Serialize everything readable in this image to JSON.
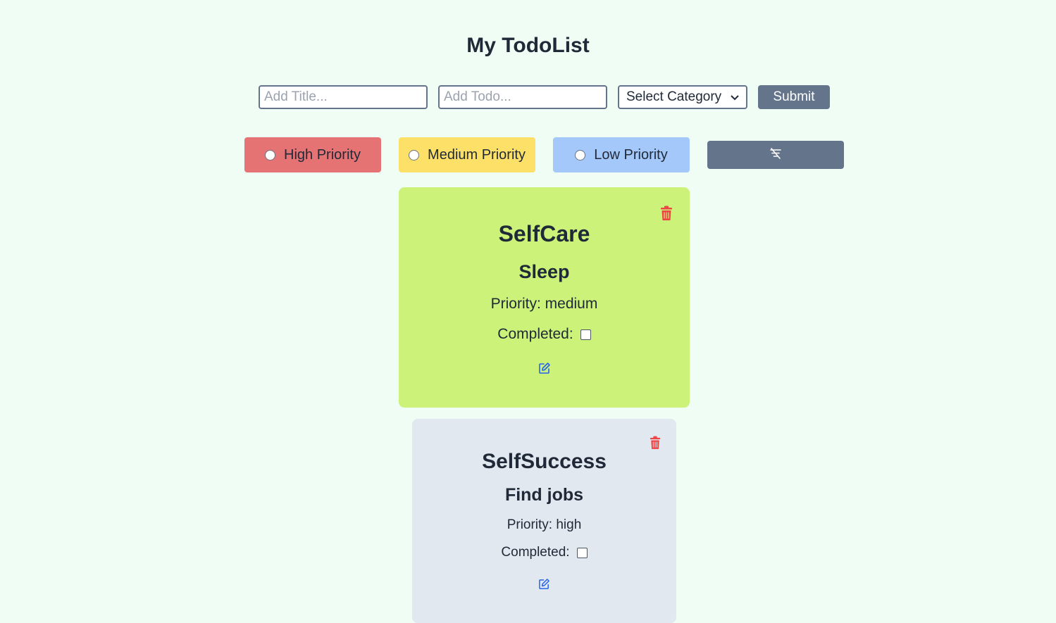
{
  "header": {
    "title": "My TodoList"
  },
  "form": {
    "title_placeholder": "Add Title...",
    "todo_placeholder": "Add Todo...",
    "category_selected": "Select Category",
    "submit_label": "Submit"
  },
  "filters": {
    "high_label": "High Priority",
    "medium_label": "Medium Priority",
    "low_label": "Low Priority",
    "clear_icon": "filter-off-icon"
  },
  "colors": {
    "high": "#e57373",
    "medium": "#fde068",
    "low": "#a5c8fa",
    "delete": "#ef4444",
    "edit": "#2563eb"
  },
  "todos": [
    {
      "category": "SelfCare",
      "title": "Sleep",
      "priority_text": "Priority: medium",
      "completed_label": "Completed:",
      "completed": false
    },
    {
      "category": "SelfSuccess",
      "title": "Find jobs",
      "priority_text": "Priority: high",
      "completed_label": "Completed:",
      "completed": false
    }
  ]
}
